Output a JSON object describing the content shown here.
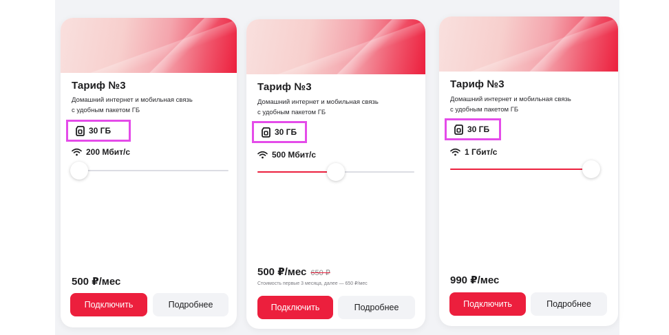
{
  "cards": [
    {
      "title": "Тариф №3",
      "description_line1": "Домашний интернет и мобильная связь",
      "description_line2": "с удобным пакетом ГБ",
      "package": "30 ГБ",
      "speed": "200 Мбит/с",
      "slider_fraction": 0.0,
      "price": "500 ₽/мес",
      "old_price": "",
      "note": "",
      "connect_label": "Подключить",
      "details_label": "Подробнее"
    },
    {
      "title": "Тариф №3",
      "description_line1": "Домашний интернет и мобильная связь",
      "description_line2": "с удобным пакетом ГБ",
      "package": "30 ГБ",
      "speed": "500 Мбит/с",
      "slider_fraction": 0.5,
      "price": "500 ₽/мес",
      "old_price": "650 ₽",
      "note": "Стоимость первые 3 месяца, далее — 650 ₽/мес",
      "connect_label": "Подключить",
      "details_label": "Подробнее"
    },
    {
      "title": "Тариф №3",
      "description_line1": "Домашний интернет и мобильная связь",
      "description_line2": "с удобным пакетом ГБ",
      "package": "30 ГБ",
      "speed": "1 Гбит/с",
      "slider_fraction": 1.0,
      "price": "990 ₽/мес",
      "old_price": "",
      "note": "",
      "connect_label": "Подключить",
      "details_label": "Подробнее"
    }
  ],
  "colors": {
    "accent": "#ec1f3d",
    "highlight_border": "#e44be9",
    "secondary_button": "#f2f3f6"
  },
  "icons": {
    "package": "sim-card-icon",
    "speed": "wifi-icon"
  }
}
